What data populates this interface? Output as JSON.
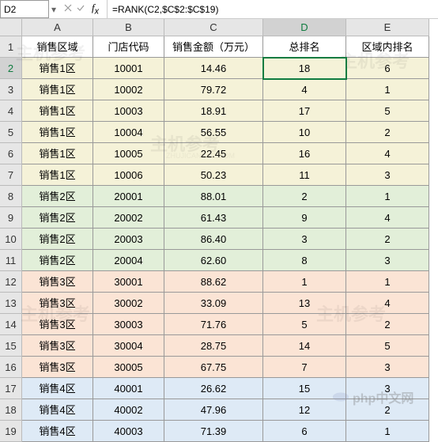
{
  "formula_bar": {
    "cell_ref": "D2",
    "formula": "=RANK(C2,$C$2:$C$19)"
  },
  "cols": [
    "A",
    "B",
    "C",
    "D",
    "E"
  ],
  "rows": [
    "1",
    "2",
    "3",
    "4",
    "5",
    "6",
    "7",
    "8",
    "9",
    "10",
    "11",
    "12",
    "13",
    "14",
    "15",
    "16",
    "17",
    "18",
    "19"
  ],
  "headers": {
    "A": "销售区域",
    "B": "门店代码",
    "C": "销售金额（万元）",
    "D": "总排名",
    "E": "区域内排名"
  },
  "selected": {
    "col": "D",
    "row": "2"
  },
  "data": [
    {
      "g": 1,
      "A": "销售1区",
      "B": "10001",
      "C": "14.46",
      "D": "18",
      "E": "6"
    },
    {
      "g": 1,
      "A": "销售1区",
      "B": "10002",
      "C": "79.72",
      "D": "4",
      "E": "1"
    },
    {
      "g": 1,
      "A": "销售1区",
      "B": "10003",
      "C": "18.91",
      "D": "17",
      "E": "5"
    },
    {
      "g": 1,
      "A": "销售1区",
      "B": "10004",
      "C": "56.55",
      "D": "10",
      "E": "2"
    },
    {
      "g": 1,
      "A": "销售1区",
      "B": "10005",
      "C": "22.45",
      "D": "16",
      "E": "4"
    },
    {
      "g": 1,
      "A": "销售1区",
      "B": "10006",
      "C": "50.23",
      "D": "11",
      "E": "3"
    },
    {
      "g": 2,
      "A": "销售2区",
      "B": "20001",
      "C": "88.01",
      "D": "2",
      "E": "1"
    },
    {
      "g": 2,
      "A": "销售2区",
      "B": "20002",
      "C": "61.43",
      "D": "9",
      "E": "4"
    },
    {
      "g": 2,
      "A": "销售2区",
      "B": "20003",
      "C": "86.40",
      "D": "3",
      "E": "2"
    },
    {
      "g": 2,
      "A": "销售2区",
      "B": "20004",
      "C": "62.60",
      "D": "8",
      "E": "3"
    },
    {
      "g": 3,
      "A": "销售3区",
      "B": "30001",
      "C": "88.62",
      "D": "1",
      "E": "1"
    },
    {
      "g": 3,
      "A": "销售3区",
      "B": "30002",
      "C": "33.09",
      "D": "13",
      "E": "4"
    },
    {
      "g": 3,
      "A": "销售3区",
      "B": "30003",
      "C": "71.76",
      "D": "5",
      "E": "2"
    },
    {
      "g": 3,
      "A": "销售3区",
      "B": "30004",
      "C": "28.75",
      "D": "14",
      "E": "5"
    },
    {
      "g": 3,
      "A": "销售3区",
      "B": "30005",
      "C": "67.75",
      "D": "7",
      "E": "3"
    },
    {
      "g": 4,
      "A": "销售4区",
      "B": "40001",
      "C": "26.62",
      "D": "15",
      "E": "3"
    },
    {
      "g": 4,
      "A": "销售4区",
      "B": "40002",
      "C": "47.96",
      "D": "12",
      "E": "2"
    },
    {
      "g": 4,
      "A": "销售4区",
      "B": "40003",
      "C": "71.39",
      "D": "6",
      "E": "1"
    }
  ],
  "watermarks": {
    "text": "主机参考",
    "sub": "ZHUJICANKAO.COM",
    "php": "php中文网"
  }
}
